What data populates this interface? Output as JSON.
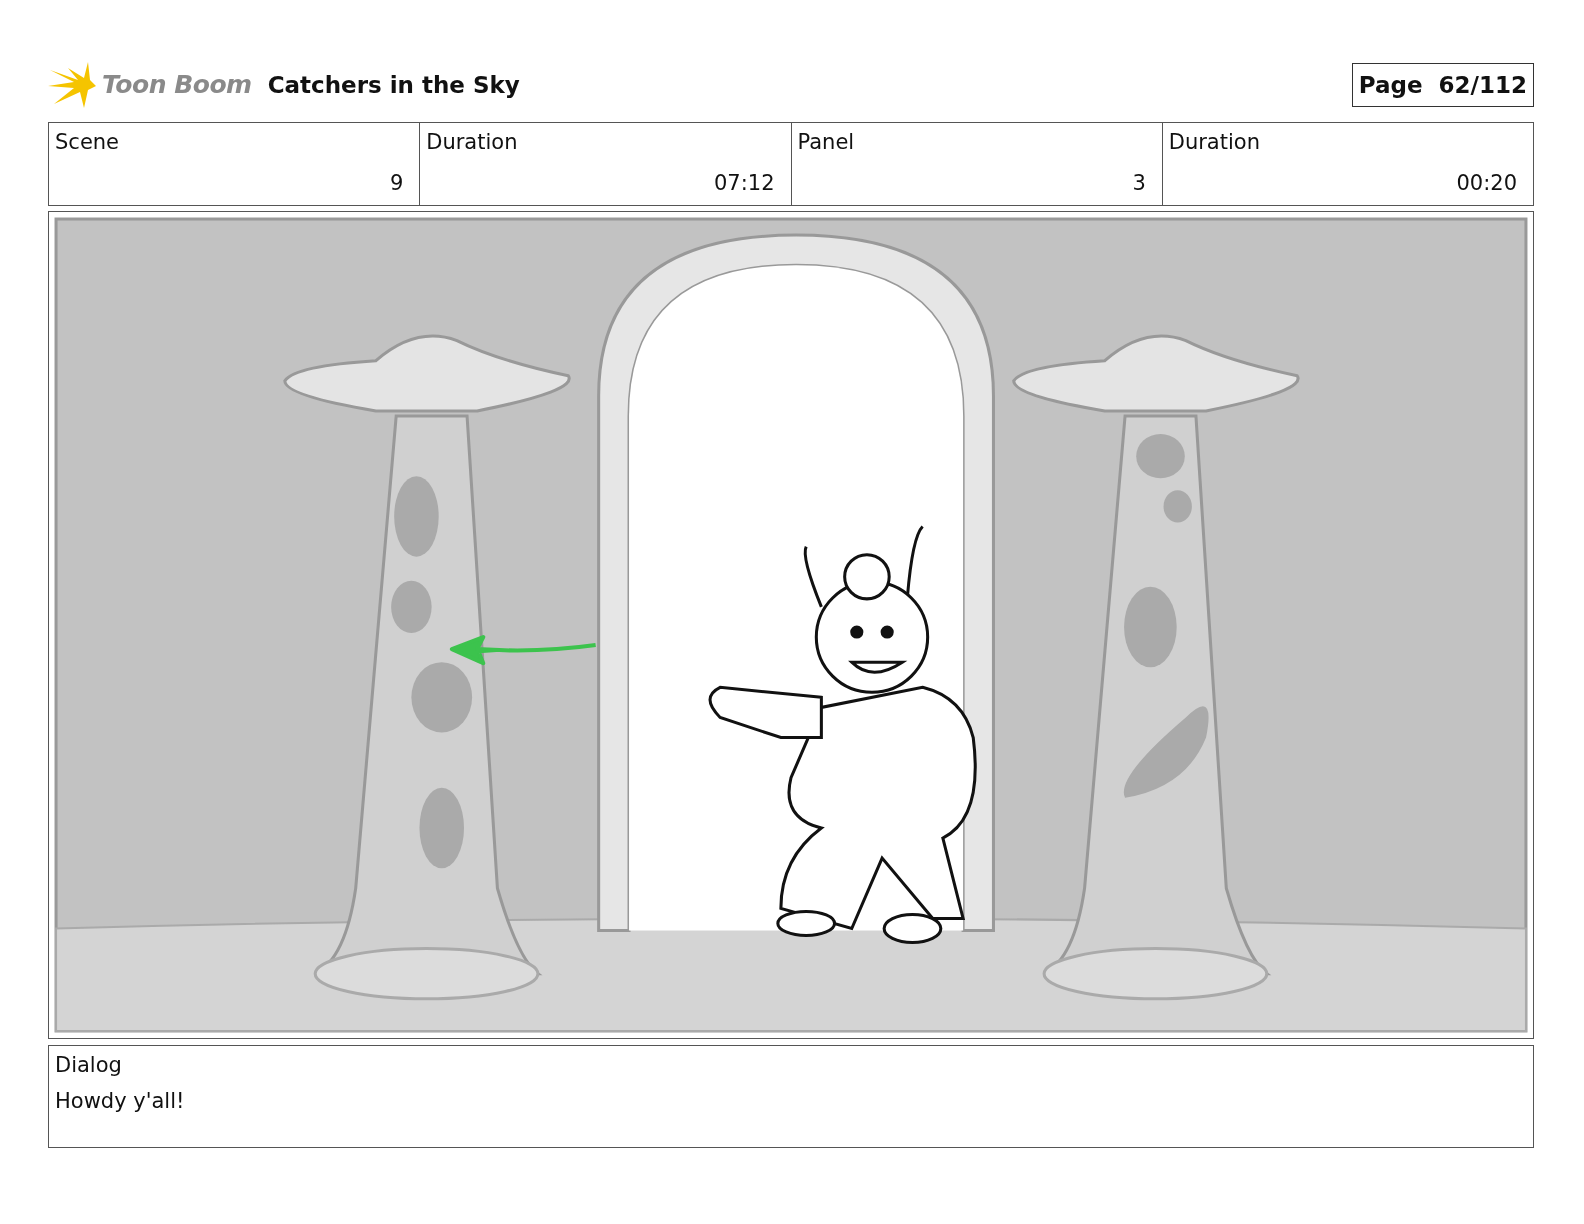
{
  "header": {
    "logo_text": "Toon Boom",
    "title": "Catchers in the Sky",
    "page_label": "Page",
    "page_number": "62/112"
  },
  "fields": [
    {
      "label": "Scene",
      "value": "9"
    },
    {
      "label": "Duration",
      "value": "07:12"
    },
    {
      "label": "Panel",
      "value": "3"
    },
    {
      "label": "Duration",
      "value": "00:20"
    }
  ],
  "dialog": {
    "label": "Dialog",
    "text": "Howdy y'all!"
  }
}
